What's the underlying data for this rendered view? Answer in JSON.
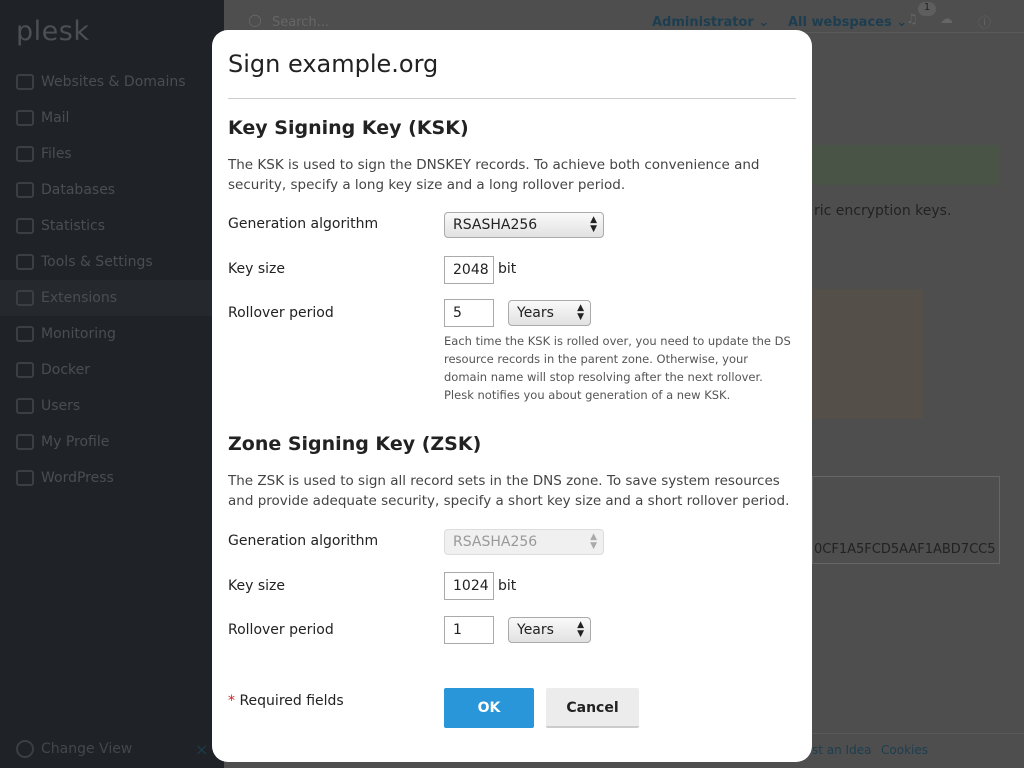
{
  "sidebar": {
    "logo": "plesk",
    "items": [
      {
        "label": "Websites & Domains",
        "icon": "monitor-icon"
      },
      {
        "label": "Mail",
        "icon": "mail-icon"
      },
      {
        "label": "Files",
        "icon": "folder-icon"
      },
      {
        "label": "Databases",
        "icon": "database-icon"
      },
      {
        "label": "Statistics",
        "icon": "chart-icon"
      },
      {
        "label": "Tools & Settings",
        "icon": "sliders-icon"
      },
      {
        "label": "Extensions",
        "icon": "extensions-icon",
        "active": true
      },
      {
        "label": "Monitoring",
        "icon": "monitoring-icon"
      },
      {
        "label": "Docker",
        "icon": "docker-icon"
      },
      {
        "label": "Users",
        "icon": "user-icon"
      },
      {
        "label": "My Profile",
        "icon": "profile-icon"
      },
      {
        "label": "WordPress",
        "icon": "wordpress-icon"
      }
    ],
    "change_view": "Change View",
    "close": "×"
  },
  "topbar": {
    "search_placeholder": "Search...",
    "user": "Administrator ⌄",
    "webspaces": "All webspaces ⌄",
    "notifications_count": "1"
  },
  "background": {
    "text_fragment": "ric encryption keys.",
    "key_fragment": "0CF1A5FCD5AAF1ABD7CC5",
    "footer_idea": "st an Idea",
    "footer_cookies": "Cookies"
  },
  "modal": {
    "title": "Sign example.org",
    "ksk": {
      "heading": "Key Signing Key (KSK)",
      "description": "The KSK is used to sign the DNSKEY records. To achieve both convenience and security, specify a long key size and a long rollover period.",
      "algorithm_label": "Generation algorithm",
      "algorithm": "RSASHA256",
      "key_size_label": "Key size",
      "key_size": "2048",
      "unit": "bit",
      "rollover_label": "Rollover period",
      "rollover": "5",
      "rollover_unit": "Years",
      "hint": "Each time the KSK is rolled over, you need to update the DS resource records in the parent zone. Otherwise, your domain name will stop resolving after the next rollover. Plesk notifies you about generation of a new KSK."
    },
    "zsk": {
      "heading": "Zone Signing Key (ZSK)",
      "description": "The ZSK is used to sign all record sets in the DNS zone. To save system resources and provide adequate security, specify a short key size and a short rollover period.",
      "algorithm_label": "Generation algorithm",
      "algorithm": "RSASHA256",
      "key_size_label": "Key size",
      "key_size": "1024",
      "unit": "bit",
      "rollover_label": "Rollover period",
      "rollover": "1",
      "rollover_unit": "Years"
    },
    "required_star": "*",
    "required": "Required fields",
    "ok": "OK",
    "cancel": "Cancel"
  },
  "colors": {
    "primary": "#2896d9",
    "sidebar": "#1f2226"
  }
}
